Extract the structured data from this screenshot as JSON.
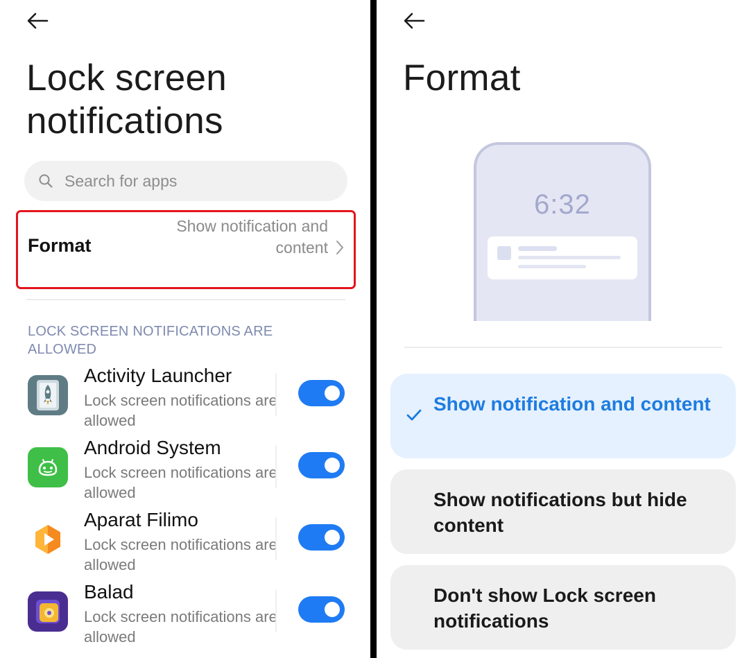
{
  "left": {
    "title": "Lock screen notifications",
    "search": {
      "placeholder": "Search for apps"
    },
    "format": {
      "label": "Format",
      "value": "Show notification and content"
    },
    "section_header": "LOCK SCREEN NOTIFICATIONS ARE ALLOWED",
    "apps": [
      {
        "name": "Activity Launcher",
        "status": "Lock screen notifications are allowed",
        "enabled": true,
        "icon": "rocket-icon"
      },
      {
        "name": "Android System",
        "status": "Lock screen notifications are allowed",
        "enabled": true,
        "icon": "android-icon"
      },
      {
        "name": "Aparat Filimo",
        "status": "Lock screen notifications are allowed",
        "enabled": true,
        "icon": "play-icon"
      },
      {
        "name": "Balad",
        "status": "Lock screen notifications are allowed",
        "enabled": true,
        "icon": "balad-icon"
      }
    ]
  },
  "right": {
    "title": "Format",
    "preview_time": "6:32",
    "options": [
      {
        "label": "Show notification and content",
        "selected": true
      },
      {
        "label": "Show notifications but hide content",
        "selected": false
      },
      {
        "label": "Don't show Lock screen notifications",
        "selected": false
      }
    ]
  },
  "colors": {
    "accent": "#1f7bf3",
    "selected_text": "#1e7ce0",
    "selected_bg": "#e5f1fe",
    "highlight_border": "#e4141d",
    "section_header": "#7e8aaf"
  }
}
